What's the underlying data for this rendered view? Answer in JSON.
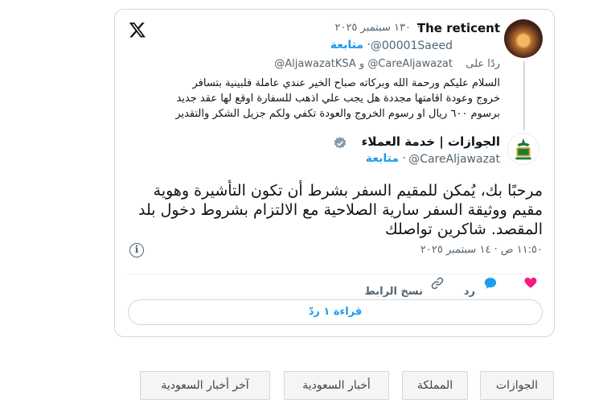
{
  "tweet": {
    "author_name": "The reticent",
    "date": "١٣٠ سبتمبر ٢٠٢٥",
    "separator": "·",
    "handle": "@00001Saeed",
    "follow_label": "متابعة",
    "reply_to_prefix": "ردًا على",
    "reply_to_handles": "@AljawazatKSA و @CareAljawazat",
    "quoted_lines": [
      "السلام عليكم ورحمة الله وبركاته صباح الخير عندي عاملة فلبينية بتسافر",
      "خروج وعودة اقامتها مجددة هل يجب علي اذهب للسفارة اوقع لها عقد جديد",
      "برسوم ٦٠٠ ريال او رسوم الخروج والعودة تكفي ولكم جزيل الشكر والتقدير"
    ]
  },
  "reply": {
    "author_name": "الجوازات | خدمة العملاء",
    "handle": "@CareAljawazat",
    "follow_label": "متابعة",
    "text": "مرحبًا بك، يُمكن للمقيم السفر بشرط أن تكون التأشيرة وهوية مقيم ووثيقة السفر سارية الصلاحية مع الالتزام بشروط دخول بلد المقصد. شاكرين تواصلك",
    "timestamp": "١١:٥٠ ص · ١٤ سبتمبر ٢٠٢٥"
  },
  "actions": {
    "reply_label": "رد",
    "copy_link_label": "نسخ الرابط",
    "read_replies_label": "قراءة ١ ردّ"
  },
  "tags": [
    "الجوازات",
    "المملكة",
    "أخبار السعودية",
    "آخر أخبار السعودية"
  ],
  "colors": {
    "accent": "#1d9bf0",
    "like": "#f91880",
    "verified_grey": "#829aab",
    "border": "#cfd9de"
  },
  "icons": [
    "x-logo-icon",
    "verified-badge-icon",
    "info-icon",
    "heart-icon",
    "chat-bubble-icon",
    "link-icon"
  ]
}
